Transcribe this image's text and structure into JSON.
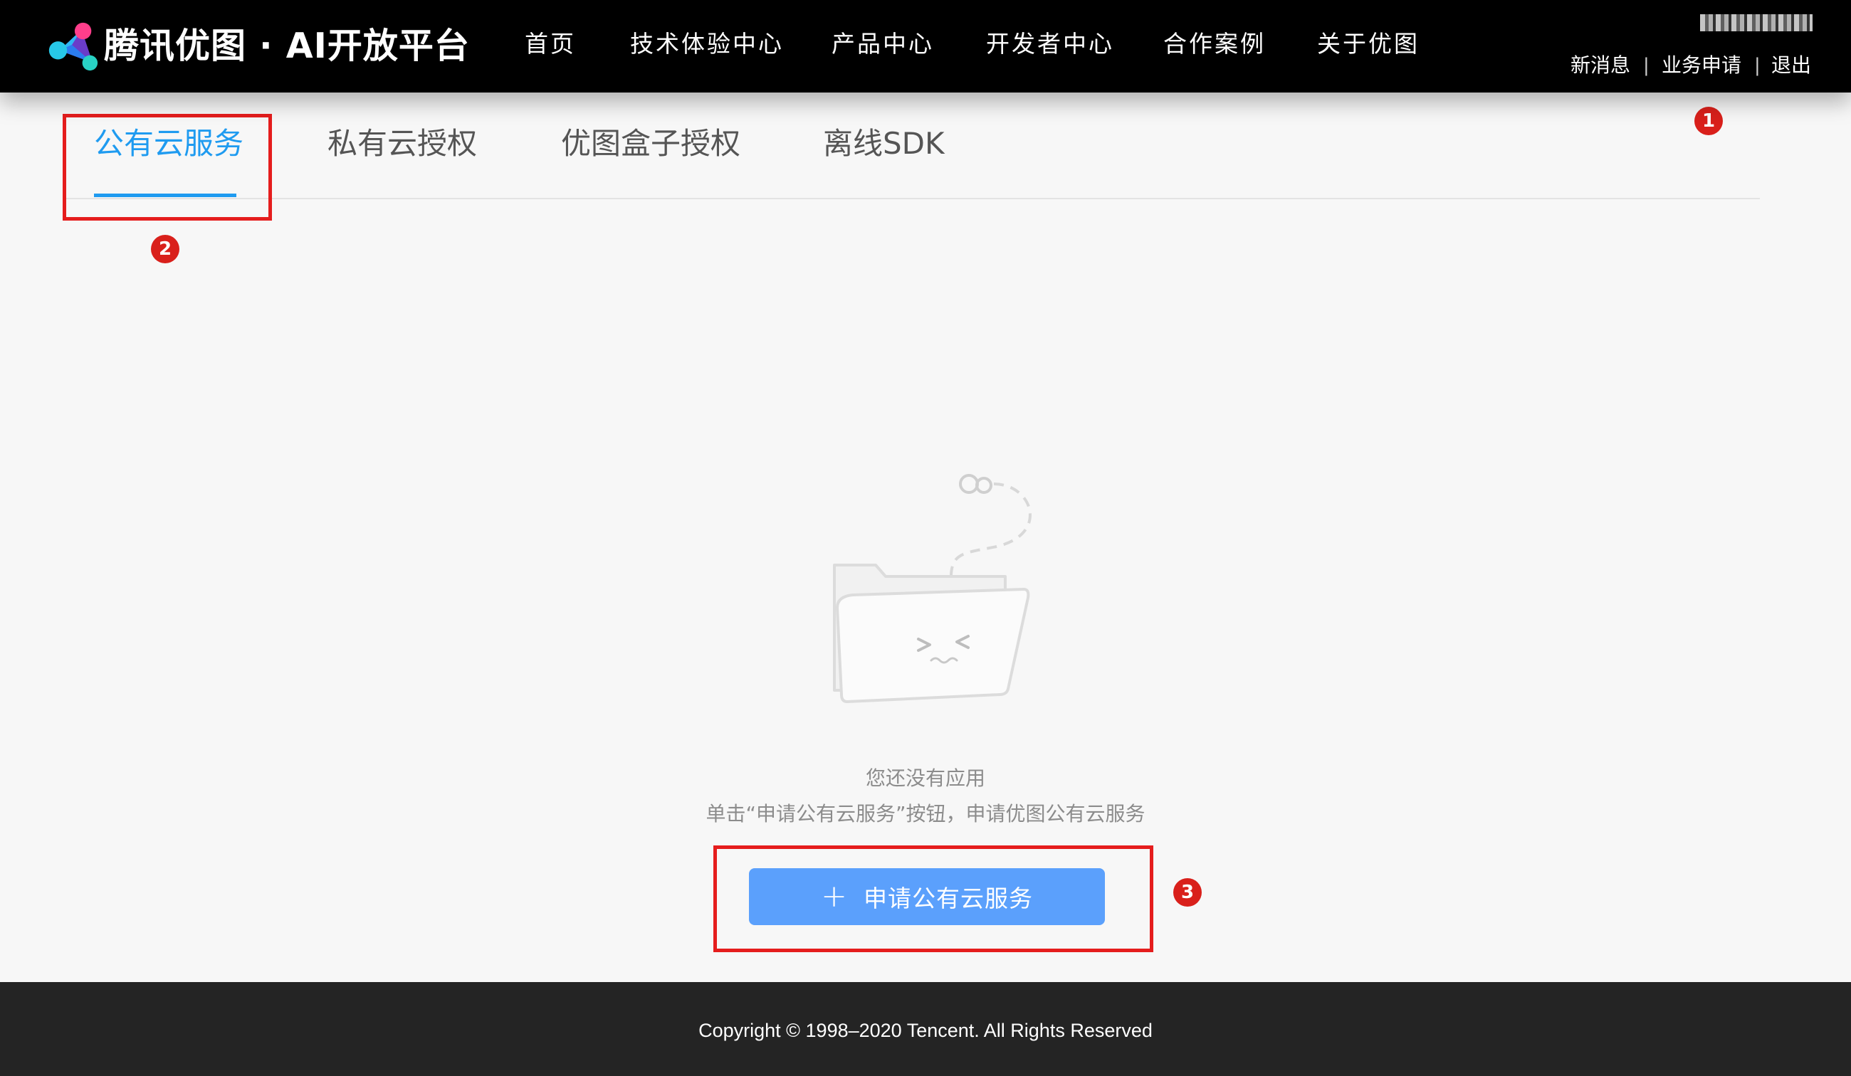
{
  "header": {
    "brand": "腾讯优图 · AI开放平台",
    "nav": [
      "首页",
      "技术体验中心",
      "产品中心",
      "开发者中心",
      "合作案例",
      "关于优图"
    ],
    "user_links": {
      "messages": "新消息",
      "separator": "|",
      "business_apply": "业务申请",
      "logout": "退出"
    }
  },
  "tabs": [
    "公有云服务",
    "私有云授权",
    "优图盒子授权",
    "离线SDK"
  ],
  "empty_state": {
    "title": "您还没有应用",
    "hint": "单击“申请公有云服务”按钮，申请优图公有云服务",
    "button_label": "申请公有云服务"
  },
  "annotations": [
    "1",
    "2",
    "3"
  ],
  "footer": {
    "copyright": "Copyright © 1998–2020 Tencent. All Rights Reserved"
  },
  "colors": {
    "accent": "#1f9bf0",
    "button": "#5ba0fc",
    "annotation": "#e51d1d",
    "topbar": "#000000",
    "footer": "#242424"
  }
}
